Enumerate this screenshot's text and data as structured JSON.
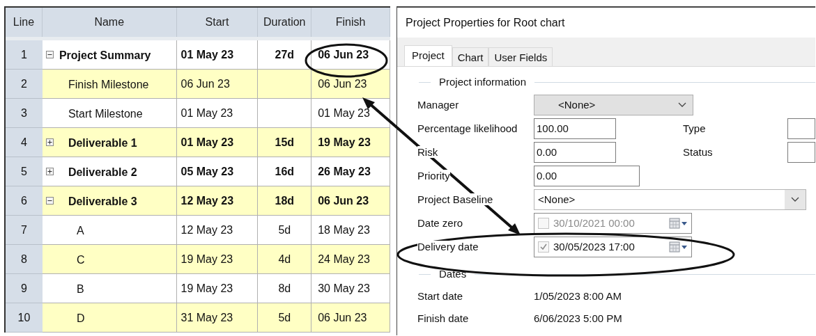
{
  "table": {
    "columns": [
      "Line",
      "Name",
      "Start",
      "Duration",
      "Finish"
    ],
    "rows": [
      {
        "line": "1",
        "name": "Project Summary",
        "start": "01 May 23",
        "duration": "27d",
        "finish": "06 Jun 23",
        "kind": "summary",
        "expanded": true,
        "children": [
          {
            "line": "2",
            "name": "Finish Milestone",
            "start": "06 Jun 23",
            "finish": "06 Jun 23",
            "kind": "task"
          },
          {
            "line": "3",
            "name": "Start Milestone",
            "start": "01 May 23",
            "finish": "01 May 23",
            "kind": "task"
          },
          {
            "line": "4",
            "name": "Deliverable 1",
            "start": "01 May 23",
            "duration": "15d",
            "finish": "19 May 23",
            "kind": "summary",
            "expanded": false
          },
          {
            "line": "5",
            "name": "Deliverable 2",
            "start": "05 May 23",
            "duration": "16d",
            "finish": "26 May 23",
            "kind": "summary",
            "expanded": false
          },
          {
            "line": "6",
            "name": "Deliverable 3",
            "start": "12 May 23",
            "duration": "18d",
            "finish": "06 Jun 23",
            "kind": "summary",
            "expanded": true,
            "children": [
              {
                "line": "7",
                "name": "A",
                "start": "12 May 23",
                "duration": "5d",
                "finish": "18 May 23",
                "kind": "task"
              },
              {
                "line": "8",
                "name": "C",
                "start": "19 May 23",
                "duration": "4d",
                "finish": "24 May 23",
                "kind": "task"
              },
              {
                "line": "9",
                "name": "B",
                "start": "19 May 23",
                "duration": "8d",
                "finish": "30 May 23",
                "kind": "task"
              },
              {
                "line": "10",
                "name": "D",
                "start": "31 May 23",
                "duration": "5d",
                "finish": "06 Jun 23",
                "kind": "task"
              }
            ]
          }
        ]
      }
    ]
  },
  "dialog": {
    "title": "Project Properties for Root chart",
    "tabs": [
      {
        "label": "Project",
        "selected": true
      },
      {
        "label": "Chart",
        "selected": false
      },
      {
        "label": "User Fields",
        "selected": false
      }
    ],
    "project_information": {
      "heading": "Project information",
      "fields": [
        {
          "kind": "select",
          "label": "Manager",
          "value": "<None>"
        },
        {
          "kind": "text",
          "label": "Percentage likelihood",
          "value": "100.00",
          "side_label": "Type"
        },
        {
          "kind": "text",
          "label": "Risk",
          "value": "0.00",
          "side_label": "Status"
        },
        {
          "kind": "text",
          "label": "Priority",
          "value": "0.00"
        },
        {
          "kind": "combo",
          "label": "Project Baseline",
          "value": "<None>"
        },
        {
          "kind": "date",
          "label": "Date zero",
          "value": "30/10/2021 00:00",
          "checked": false
        },
        {
          "kind": "date",
          "label": "Delivery date",
          "value": "30/05/2023 17:00",
          "checked": true
        }
      ]
    },
    "dates": {
      "heading": "Dates",
      "items": [
        {
          "label": "Start date",
          "value": "1/05/2023 8:00 AM"
        },
        {
          "label": "Finish date",
          "value": "6/06/2023 5:00 PM"
        }
      ]
    }
  }
}
